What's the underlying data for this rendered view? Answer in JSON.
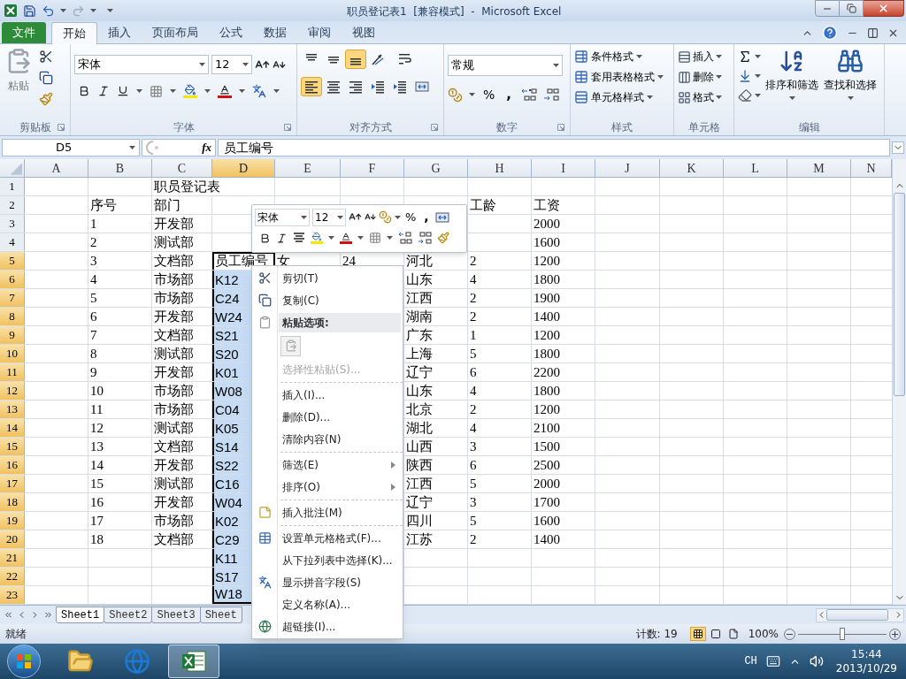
{
  "window": {
    "title": "职员登记表1  [兼容模式]  -  Microsoft Excel"
  },
  "ribbon_tabs": [
    {
      "label": "文件",
      "kind": "file",
      "selected": false
    },
    {
      "label": "开始",
      "kind": "tab",
      "selected": true
    },
    {
      "label": "插入",
      "kind": "tab",
      "selected": false
    },
    {
      "label": "页面布局",
      "kind": "tab",
      "selected": false
    },
    {
      "label": "公式",
      "kind": "tab",
      "selected": false
    },
    {
      "label": "数据",
      "kind": "tab",
      "selected": false
    },
    {
      "label": "审阅",
      "kind": "tab",
      "selected": false
    },
    {
      "label": "视图",
      "kind": "tab",
      "selected": false
    }
  ],
  "clipboard": {
    "paste": "粘贴",
    "label": "剪贴板"
  },
  "font": {
    "font_name": "宋体",
    "font_size": "12",
    "label": "字体"
  },
  "alignment": {
    "label": "对齐方式",
    "buttons": [
      {
        "kind": "top",
        "selected": false
      },
      {
        "kind": "middle",
        "selected": false
      },
      {
        "kind": "bottom",
        "selected": true
      },
      {
        "kind": "orientation",
        "selected": false
      },
      {
        "kind": "wrap",
        "selected": false
      },
      {
        "kind": "left",
        "selected": true
      },
      {
        "kind": "center",
        "selected": false
      },
      {
        "kind": "right",
        "selected": false
      },
      {
        "kind": "outdent",
        "selected": false
      },
      {
        "kind": "indent",
        "selected": false
      },
      {
        "kind": "merge",
        "selected": false
      }
    ]
  },
  "number": {
    "format": "常规",
    "percent": "%",
    "comma": ",",
    "label": "数字"
  },
  "styles": {
    "items": [
      "条件格式",
      "套用表格格式",
      "单元格样式"
    ],
    "label": "样式"
  },
  "cells": {
    "items": [
      "插入",
      "删除",
      "格式"
    ],
    "label": "单元格"
  },
  "editing": {
    "items": [
      "排序和筛选",
      "查找和选择"
    ],
    "label": "编辑"
  },
  "formula_bar": {
    "name_box": "D5",
    "function_label": "fx",
    "value": "员工编号"
  },
  "columns": [
    {
      "label": "A",
      "selected": false
    },
    {
      "label": "B",
      "selected": false
    },
    {
      "label": "C",
      "selected": false
    },
    {
      "label": "D",
      "selected": true
    },
    {
      "label": "E",
      "selected": false
    },
    {
      "label": "F",
      "selected": false
    },
    {
      "label": "G",
      "selected": false
    },
    {
      "label": "H",
      "selected": false
    },
    {
      "label": "I",
      "selected": false
    },
    {
      "label": "J",
      "selected": false
    },
    {
      "label": "K",
      "selected": false
    },
    {
      "label": "L",
      "selected": false
    },
    {
      "label": "M",
      "selected": false
    },
    {
      "label": "N",
      "selected": false
    }
  ],
  "rows": [
    {
      "number": "1",
      "selected": false,
      "cells": {
        "C": "职员登记表"
      }
    },
    {
      "number": "2",
      "selected": false,
      "cells": {
        "B": "序号",
        "C": "部门",
        "H": "工龄",
        "I": "工资"
      }
    },
    {
      "number": "3",
      "selected": false,
      "cells": {
        "B": "1",
        "C": "开发部",
        "I": "2000"
      }
    },
    {
      "number": "4",
      "selected": false,
      "cells": {
        "B": "2",
        "C": "测试部",
        "I": "1600"
      }
    },
    {
      "number": "5",
      "selected": true,
      "cells": {
        "B": "3",
        "C": "文档部",
        "D": "员工编号",
        "E": "女",
        "F": "24",
        "G": "河北",
        "H": "2",
        "I": "1200"
      }
    },
    {
      "number": "6",
      "selected": true,
      "cells": {
        "B": "4",
        "C": "市场部",
        "D": "K12",
        "G": "山东",
        "H": "4",
        "I": "1800"
      }
    },
    {
      "number": "7",
      "selected": true,
      "cells": {
        "B": "5",
        "C": "市场部",
        "D": "C24",
        "G": "江西",
        "H": "2",
        "I": "1900"
      }
    },
    {
      "number": "8",
      "selected": true,
      "cells": {
        "B": "6",
        "C": "开发部",
        "D": "W24",
        "G": "湖南",
        "H": "2",
        "I": "1400"
      }
    },
    {
      "number": "9",
      "selected": true,
      "cells": {
        "B": "7",
        "C": "文档部",
        "D": "S21",
        "G": "广东",
        "H": "1",
        "I": "1200"
      }
    },
    {
      "number": "10",
      "selected": true,
      "cells": {
        "B": "8",
        "C": "测试部",
        "D": "S20",
        "G": "上海",
        "H": "5",
        "I": "1800"
      }
    },
    {
      "number": "11",
      "selected": true,
      "cells": {
        "B": "9",
        "C": "开发部",
        "D": "K01",
        "G": "辽宁",
        "H": "6",
        "I": "2200"
      }
    },
    {
      "number": "12",
      "selected": true,
      "cells": {
        "B": "10",
        "C": "市场部",
        "D": "W08",
        "G": "山东",
        "H": "4",
        "I": "1800"
      }
    },
    {
      "number": "13",
      "selected": true,
      "cells": {
        "B": "11",
        "C": "市场部",
        "D": "C04",
        "G": "北京",
        "H": "2",
        "I": "1200"
      }
    },
    {
      "number": "14",
      "selected": true,
      "cells": {
        "B": "12",
        "C": "测试部",
        "D": "K05",
        "G": "湖北",
        "H": "4",
        "I": "2100"
      }
    },
    {
      "number": "15",
      "selected": true,
      "cells": {
        "B": "13",
        "C": "文档部",
        "D": "S14",
        "G": "山西",
        "H": "3",
        "I": "1500"
      }
    },
    {
      "number": "16",
      "selected": true,
      "cells": {
        "B": "14",
        "C": "开发部",
        "D": "S22",
        "G": "陕西",
        "H": "6",
        "I": "2500"
      }
    },
    {
      "number": "17",
      "selected": true,
      "cells": {
        "B": "15",
        "C": "测试部",
        "D": "C16",
        "G": "江西",
        "H": "5",
        "I": "2000"
      }
    },
    {
      "number": "18",
      "selected": true,
      "cells": {
        "B": "16",
        "C": "开发部",
        "D": "W04",
        "G": "辽宁",
        "H": "3",
        "I": "1700"
      }
    },
    {
      "number": "19",
      "selected": true,
      "cells": {
        "B": "17",
        "C": "市场部",
        "D": "K02",
        "G": "四川",
        "H": "5",
        "I": "1600"
      }
    },
    {
      "number": "20",
      "selected": true,
      "cells": {
        "B": "18",
        "C": "文档部",
        "D": "C29",
        "G": "江苏",
        "H": "2",
        "I": "1400"
      }
    },
    {
      "number": "21",
      "selected": true,
      "cells": {
        "D": "K11"
      }
    },
    {
      "number": "22",
      "selected": true,
      "cells": {
        "D": "S17"
      }
    },
    {
      "number": "23",
      "selected": true,
      "cells": {
        "D": "W18"
      }
    }
  ],
  "mini_toolbar": {
    "font_name": "宋体",
    "font_size": "12",
    "percent": "%",
    "comma": ","
  },
  "context_menu": [
    {
      "kind": "item",
      "label": "剪切(T)",
      "disabled": false,
      "submenu": false
    },
    {
      "kind": "item",
      "label": "复制(C)",
      "disabled": false,
      "submenu": false
    },
    {
      "kind": "header",
      "label": "粘贴选项:"
    },
    {
      "kind": "paste_options"
    },
    {
      "kind": "item",
      "label": "选择性粘贴(S)...",
      "disabled": true,
      "submenu": false
    },
    {
      "kind": "separator"
    },
    {
      "kind": "item",
      "label": "插入(I)...",
      "disabled": false,
      "submenu": false
    },
    {
      "kind": "item",
      "label": "删除(D)...",
      "disabled": false,
      "submenu": false
    },
    {
      "kind": "item",
      "label": "清除内容(N)",
      "disabled": false,
      "submenu": false
    },
    {
      "kind": "separator"
    },
    {
      "kind": "item",
      "label": "筛选(E)",
      "disabled": false,
      "submenu": true
    },
    {
      "kind": "item",
      "label": "排序(O)",
      "disabled": false,
      "submenu": true
    },
    {
      "kind": "separator"
    },
    {
      "kind": "item",
      "label": "插入批注(M)",
      "disabled": false,
      "submenu": false
    },
    {
      "kind": "separator"
    },
    {
      "kind": "item",
      "label": "设置单元格格式(F)...",
      "disabled": false,
      "submenu": false
    },
    {
      "kind": "item",
      "label": "从下拉列表中选择(K)...",
      "disabled": false,
      "submenu": false
    },
    {
      "kind": "item",
      "label": "显示拼音字段(S)",
      "disabled": false,
      "submenu": false
    },
    {
      "kind": "item",
      "label": "定义名称(A)...",
      "disabled": false,
      "submenu": false
    },
    {
      "kind": "item",
      "label": "超链接(I)...",
      "disabled": false,
      "submenu": false
    }
  ],
  "sheet_tabs": [
    {
      "label": "Sheet1",
      "selected": true
    },
    {
      "label": "Sheet2",
      "selected": false
    },
    {
      "label": "Sheet3",
      "selected": false
    },
    {
      "label": "Sheet",
      "selected": false
    }
  ],
  "status_bar": {
    "state": "就绪",
    "count": "计数: 19",
    "views": [
      {
        "kind": "normal",
        "selected": true
      },
      {
        "kind": "layout",
        "selected": false
      },
      {
        "kind": "break",
        "selected": false
      }
    ],
    "zoom": "100%",
    "zoom_slider": {
      "level": 0.5
    }
  },
  "taskbar": {
    "apps": [
      {
        "kind": "explorer",
        "selected": false
      },
      {
        "kind": "browser",
        "selected": false
      },
      {
        "kind": "excel",
        "selected": true
      }
    ],
    "language": "CH",
    "time": "15:44",
    "date": "2013/10/29"
  }
}
